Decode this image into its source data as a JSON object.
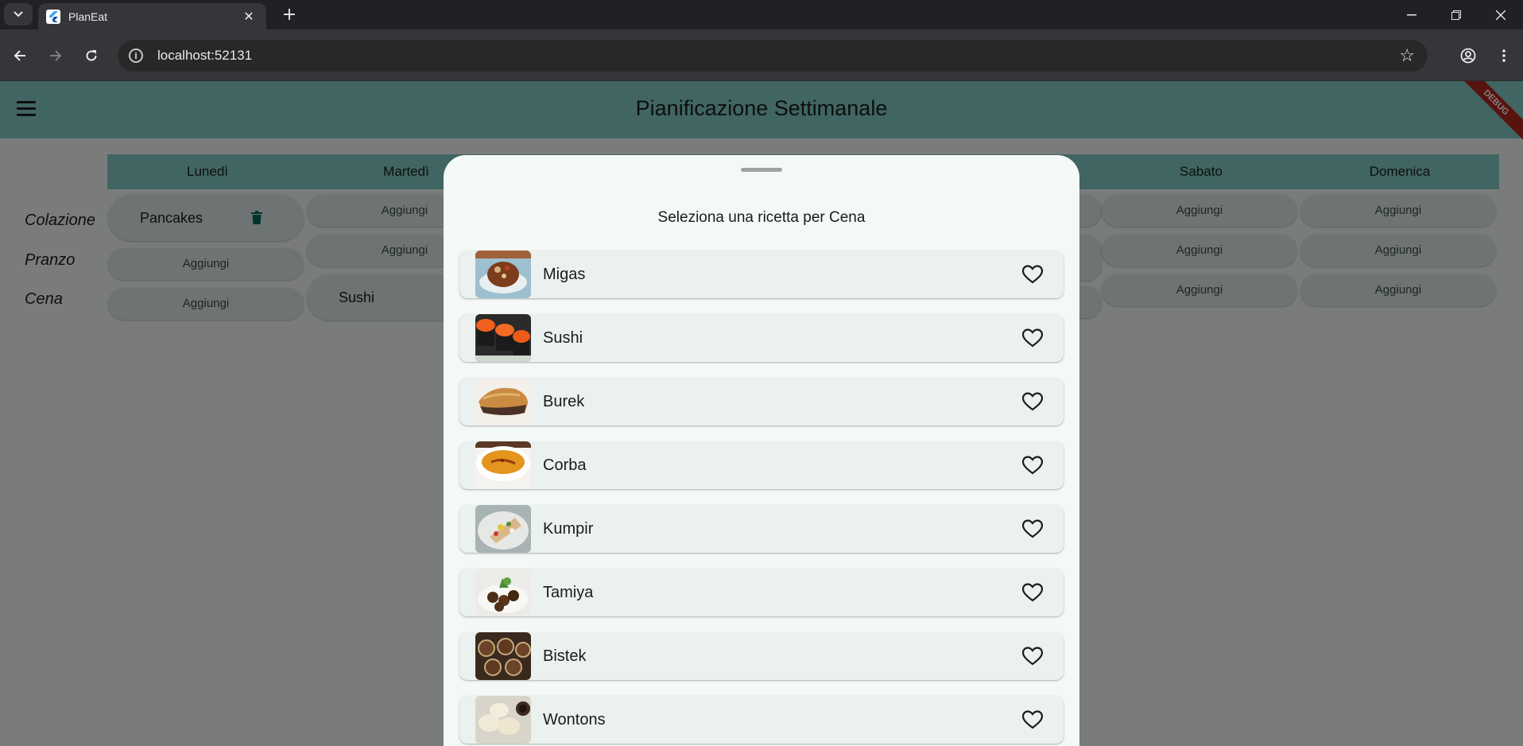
{
  "browser": {
    "tab_title": "PlanEat",
    "url": "localhost:52131",
    "window_controls": [
      "minimize-icon",
      "restore-icon",
      "close-icon"
    ]
  },
  "app": {
    "title": "Pianificazione Settimanale",
    "debug_banner": "DEBUG",
    "accent_color": "#80cbc4",
    "days": [
      {
        "label": "Lunedì"
      },
      {
        "label": "Martedì"
      },
      {
        "label": "Sabato"
      },
      {
        "label": "Domenica"
      }
    ],
    "meals": [
      "Colazione",
      "Pranzo",
      "Cena"
    ],
    "add_label": "Aggiungi",
    "planned": {
      "monday_breakfast": "Pancakes",
      "tuesday_dinner": "Sushi"
    }
  },
  "sheet": {
    "title": "Seleziona una ricetta per Cena",
    "recipes": [
      {
        "name": "Migas",
        "favorite": false
      },
      {
        "name": "Sushi",
        "favorite": false
      },
      {
        "name": "Burek",
        "favorite": false
      },
      {
        "name": "Corba",
        "favorite": false
      },
      {
        "name": "Kumpir",
        "favorite": false
      },
      {
        "name": "Tamiya",
        "favorite": false
      },
      {
        "name": "Bistek",
        "favorite": false
      },
      {
        "name": "Wontons",
        "favorite": false
      }
    ]
  }
}
